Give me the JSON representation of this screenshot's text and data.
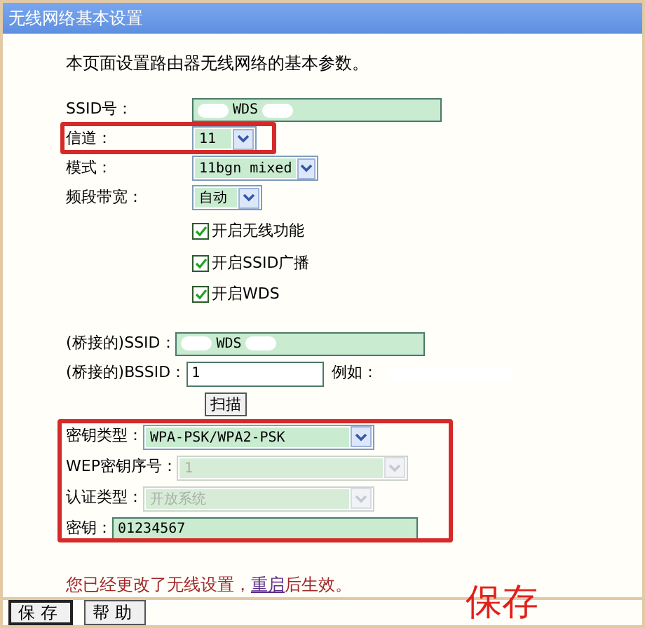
{
  "window": {
    "title": "无线网络基本设置"
  },
  "intro": "本页面设置路由器无线网络的基本参数。",
  "fields": [
    {
      "kind": "text",
      "label": "SSID号：",
      "value": "WDS",
      "highlight": false
    },
    {
      "kind": "select",
      "label": "信道：",
      "value": "11",
      "highlight": true
    },
    {
      "kind": "select",
      "label": "模式：",
      "value": "11bgn mixed",
      "highlight": false
    },
    {
      "kind": "select",
      "label": "频段带宽：",
      "value": "自动",
      "highlight": false
    }
  ],
  "options": [
    {
      "label": "开启无线功能",
      "checked": true
    },
    {
      "label": "开启SSID广播",
      "checked": true
    },
    {
      "label": "开启WDS",
      "checked": true
    }
  ],
  "bridge": {
    "ssid_label": "(桥接的)SSID：",
    "ssid_value": "WDS",
    "bssid_label": "(桥接的)BSSID：",
    "bssid_value": "1",
    "example_label": "例如：",
    "scan_button": "扫描"
  },
  "security": {
    "highlight": true,
    "rows": [
      {
        "kind": "select",
        "label": "密钥类型：",
        "value": "WPA-PSK/WPA2-PSK",
        "disabled": false
      },
      {
        "kind": "select",
        "label": "WEP密钥序号：",
        "value": "1",
        "disabled": true
      },
      {
        "kind": "select",
        "label": "认证类型：",
        "value": "开放系统",
        "disabled": true
      },
      {
        "kind": "text",
        "label": "密钥：",
        "value": "01234567"
      }
    ]
  },
  "notice": {
    "before": "您已经更改了无线设置，",
    "link": "重启",
    "after": "后生效。"
  },
  "annotation": "保存",
  "buttons": [
    "保存",
    "帮助"
  ]
}
